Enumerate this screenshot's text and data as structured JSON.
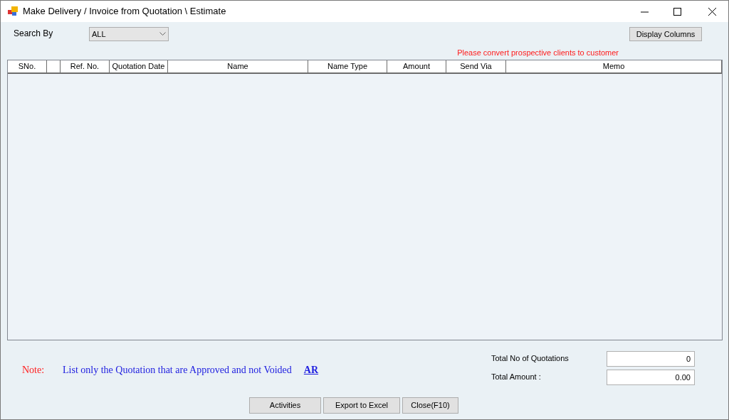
{
  "window": {
    "title": "Make Delivery / Invoice from Quotation \\ Estimate"
  },
  "search": {
    "label": "Search By",
    "value": "ALL"
  },
  "display_columns_button": "Display Columns",
  "warning": "Please convert prospective clients to customer",
  "table": {
    "columns": [
      {
        "label": "SNo."
      },
      {},
      {
        "label": "Ref. No."
      },
      {
        "label": "Quotation Date"
      },
      {
        "label": "Name"
      },
      {
        "label": "Name Type"
      },
      {
        "label": "Amount"
      },
      {
        "label": "Send Via"
      },
      {
        "label": "Memo"
      }
    ]
  },
  "note": {
    "label": "Note:",
    "text": "List only the Quotation that are Approved and not Voided",
    "link": "AR"
  },
  "totals": [
    {
      "label": "Total No of Quotations",
      "value": "0"
    },
    {
      "label": "Total Amount :",
      "value": "0.00"
    }
  ],
  "buttons": [
    "Activities",
    "Export to Excel",
    "Close(F10)"
  ]
}
